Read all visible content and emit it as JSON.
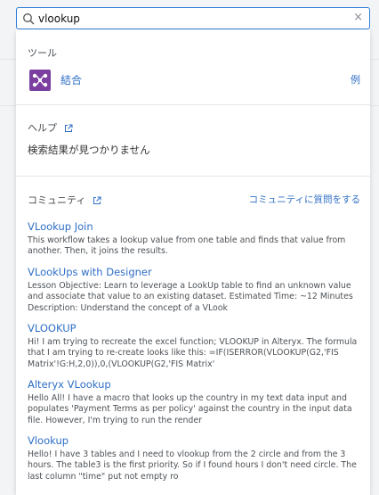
{
  "search": {
    "value": "vlookup",
    "clear_label": "×"
  },
  "tools": {
    "heading": "ツール",
    "items": [
      {
        "name": "結合",
        "example_label": "例",
        "icon": "join-tool-icon"
      }
    ]
  },
  "help": {
    "heading": "ヘルプ",
    "no_results": "検索結果が見つかりません"
  },
  "community": {
    "heading": "コミュニティ",
    "ask_label": "コミュニティに質問をする",
    "results": [
      {
        "title": "VLookup Join",
        "description": "This workflow takes a lookup value from one table and finds that value from another. Then, it joins the results."
      },
      {
        "title": "VLookUps with Designer",
        "description": "Lesson Objective: Learn to leverage a LookUp table to find an unknown value and associate that value to an existing dataset. Estimated Time: ~12 Minutes Description: Understand the concept of a VLook"
      },
      {
        "title": "VLOOKUP",
        "description": "Hi! I am trying to recreate the excel function; VLOOKUP in Alteryx. The formula that I am trying to re-create looks like this: =IF(ISERROR(VLOOKUP(G2,'FIS Matrix'!G:H,2,0)),0,(VLOOKUP(G2,'FIS Matrix'"
      },
      {
        "title": "Alteryx VLookup",
        "description": "Hello All! I have a macro that looks up the country in my text data input and populates 'Payment Terms as per policy' against the country in the input data file. However, I'm trying to run the render"
      },
      {
        "title": "Vlookup",
        "description": "Hello! I have 3 tables and I need to vlookup from the 2 circle and from the 3 hours. The table3 is the first priority. So if I found hours I don't need circle. The last column \"time\" put not empty ro"
      }
    ]
  },
  "colors": {
    "accent": "#2f7fd8",
    "link": "#2f6fc6",
    "join_icon": "#7b3fa0"
  }
}
